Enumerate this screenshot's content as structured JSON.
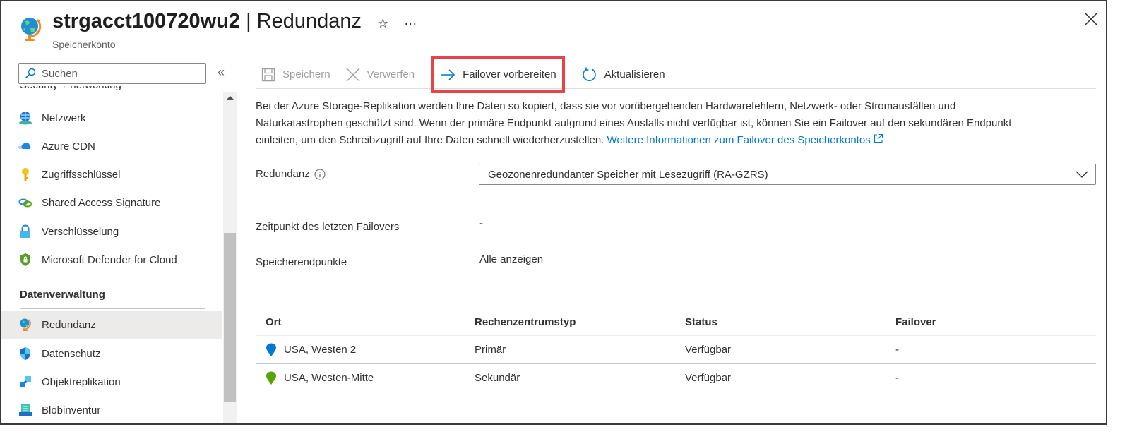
{
  "header": {
    "resource_name": "strgacct100720wu2",
    "separator": "|",
    "page_name": "Redundanz",
    "subtitle": "Speicherkonto",
    "favorite_icon": "☆",
    "more_icon": "···"
  },
  "sidebar": {
    "search_placeholder": "Suchen",
    "collapse_icon": "«",
    "cut_heading": "Security + networking",
    "items_security": [
      {
        "label": "Netzwerk",
        "icon": "network-icon"
      },
      {
        "label": "Azure CDN",
        "icon": "cdn-cloud-icon"
      },
      {
        "label": "Zugriffsschlüssel",
        "icon": "key-icon"
      },
      {
        "label": "Shared Access Signature",
        "icon": "link-icon"
      },
      {
        "label": "Verschlüsselung",
        "icon": "lock-icon"
      },
      {
        "label": "Microsoft Defender for Cloud",
        "icon": "defender-shield-icon"
      }
    ],
    "group_data": "Datenverwaltung",
    "items_data": [
      {
        "label": "Redundanz",
        "icon": "globe-icon",
        "active": true
      },
      {
        "label": "Datenschutz",
        "icon": "shield-icon"
      },
      {
        "label": "Objektreplikation",
        "icon": "replication-icon"
      },
      {
        "label": "Blobinventur",
        "icon": "inventory-icon"
      }
    ]
  },
  "toolbar": {
    "save": "Speichern",
    "discard": "Verwerfen",
    "prepare_failover": "Failover vorbereiten",
    "refresh": "Aktualisieren"
  },
  "description": {
    "text": "Bei der Azure Storage-Replikation werden Ihre Daten so kopiert, dass sie vor vorübergehenden Hardwarefehlern, Netzwerk- oder Stromausfällen und Naturkatastrophen geschützt sind. Wenn der primäre Endpunkt aufgrund eines Ausfalls nicht verfügbar ist, können Sie ein Failover auf den sekundären Endpunkt einleiten, um den Schreibzugriff auf Ihre Daten schnell wiederherzustellen.",
    "link": "Weitere Informationen zum Failover des Speicherkontos"
  },
  "form": {
    "redundancy_label": "Redundanz",
    "redundancy_value": "Geozonenredundanter Speicher mit Lesezugriff (RA-GZRS)",
    "last_failover_label": "Zeitpunkt des letzten Failovers",
    "last_failover_value": "-",
    "endpoints_label": "Speicherendpunkte",
    "endpoints_link": "Alle anzeigen"
  },
  "table": {
    "columns": [
      "Ort",
      "Rechenzentrumstyp",
      "Status",
      "Failover"
    ],
    "rows": [
      {
        "location": "USA, Westen 2",
        "type": "Primär",
        "status": "Verfügbar",
        "failover": "-",
        "pin_color": "#0078d4"
      },
      {
        "location": "USA, Westen-Mitte",
        "type": "Sekundär",
        "status": "Verfügbar",
        "failover": "-",
        "pin_color": "#57a300"
      }
    ]
  },
  "colors": {
    "accent": "#0078d4",
    "highlight_box": "#e8424a"
  }
}
